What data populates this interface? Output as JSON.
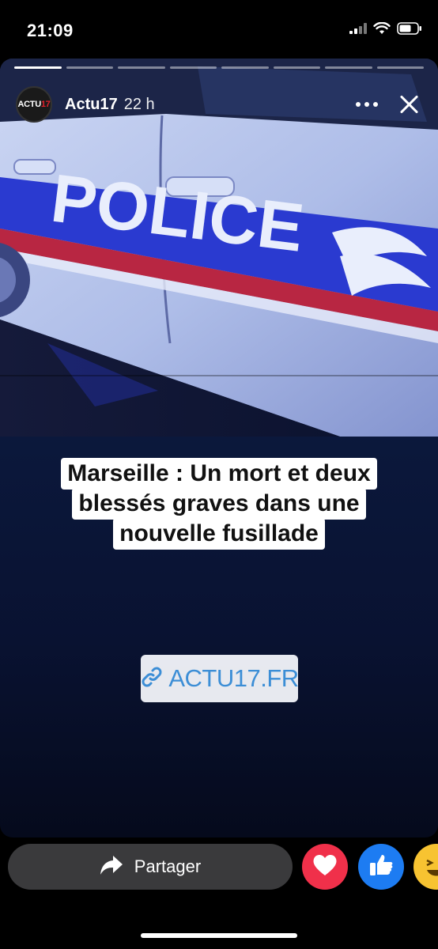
{
  "status_bar": {
    "time": "21:09",
    "icons": [
      "cellular-signal-icon",
      "wifi-icon",
      "battery-icon"
    ]
  },
  "story": {
    "progress": [
      {
        "fill": 1.0
      },
      {
        "fill": 0.0
      },
      {
        "fill": 0.0
      },
      {
        "fill": 0.0
      },
      {
        "fill": 0.0
      },
      {
        "fill": 0.0
      },
      {
        "fill": 0.0
      },
      {
        "fill": 0.0
      }
    ],
    "author": "Actu17",
    "time_ago": "22 h",
    "avatar_logo": {
      "part1": "ACTU",
      "part2": "17"
    },
    "photo_text": "POLICE",
    "headline_lines": [
      "Marseille : Un mort et deux",
      "blessés graves dans une",
      "nouvelle fusillade"
    ],
    "link_sticker": {
      "text": "ACTU17.FR",
      "icon": "link-icon"
    }
  },
  "footer": {
    "share_label": "Partager",
    "reactions": [
      "love-reaction",
      "like-reaction",
      "haha-reaction"
    ]
  },
  "colors": {
    "story_background": "#0c1a3f",
    "link_text": "#3c8ed6",
    "love": "#f0304a",
    "like": "#1d7cf2",
    "haha": "#f7c331",
    "brand_red": "#e0202c"
  }
}
